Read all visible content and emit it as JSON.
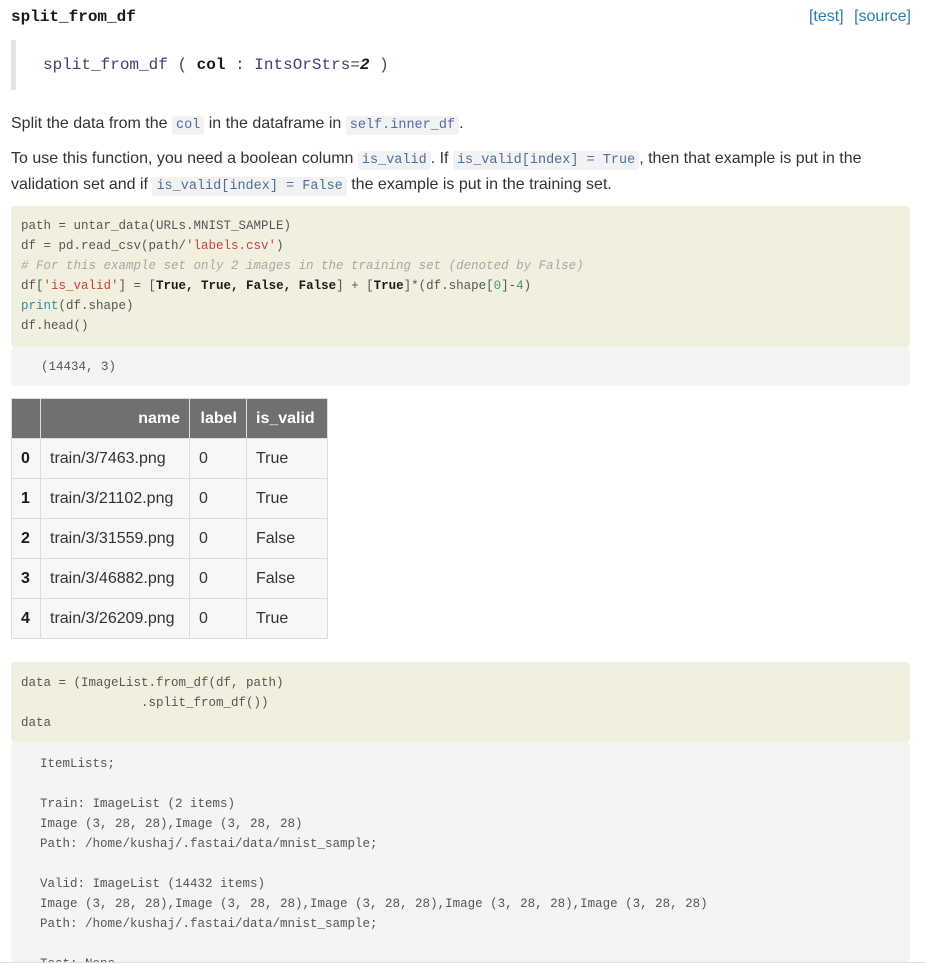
{
  "header": {
    "title": "split_from_df",
    "test_link": "[test]",
    "source_link": "[source]"
  },
  "signature": {
    "name": "split_from_df",
    "open": "(",
    "param": "col",
    "colon": ":",
    "type": "IntsOrStrs",
    "eq": "=",
    "default": "2",
    "close": ")"
  },
  "description": {
    "p1_a": "Split the data from the",
    "p1_code1": "col",
    "p1_b": "in the dataframe in",
    "p1_code2": "self.inner_df",
    "p1_c": ".",
    "p2_a": "To use this function, you need a boolean column",
    "p2_code1": "is_valid",
    "p2_b": ". If",
    "p2_code2": "is_valid[index] = True",
    "p2_c": ", then that example is put in the",
    "p2_d": "validation set and if",
    "p2_code3": "is_valid[index] = False",
    "p2_e": "the example is put in the training set."
  },
  "code1": {
    "l1_a": "path = untar_data(URLs.MNIST_SAMPLE)",
    "l2_a": "df = pd.read_csv(path/",
    "l2_str": "'labels.csv'",
    "l2_b": ")",
    "l3": "# For this example set only 2 images in the training set (denoted by False)",
    "l4_a": "df[",
    "l4_str": "'is_valid'",
    "l4_b": "] = [",
    "l4_kw": "True, True, False, False",
    "l4_c": "] + [",
    "l4_kw2": "True",
    "l4_d": "]*(df.shape[",
    "l4_n0": "0",
    "l4_e": "]-",
    "l4_n4": "4",
    "l4_f": ")",
    "l5_fn": "print",
    "l5_b": "(df.shape)",
    "l6": "df.head()"
  },
  "output1": "(14434, 3)",
  "table": {
    "headers": [
      "",
      "name",
      "label",
      "is_valid"
    ],
    "rows": [
      {
        "idx": "0",
        "name": "train/3/7463.png",
        "label": "0",
        "is_valid": "True"
      },
      {
        "idx": "1",
        "name": "train/3/21102.png",
        "label": "0",
        "is_valid": "True"
      },
      {
        "idx": "2",
        "name": "train/3/31559.png",
        "label": "0",
        "is_valid": "False"
      },
      {
        "idx": "3",
        "name": "train/3/46882.png",
        "label": "0",
        "is_valid": "False"
      },
      {
        "idx": "4",
        "name": "train/3/26209.png",
        "label": "0",
        "is_valid": "True"
      }
    ]
  },
  "code2": {
    "l1": "data = (ImageList.from_df(df, path)",
    "l2": "                .split_from_df())",
    "l3": "data"
  },
  "output2": {
    "l1": "ItemLists;",
    "l2": "Train: ImageList (2 items)",
    "l3": "Image (3, 28, 28),Image (3, 28, 28)",
    "l4": "Path: /home/kushaj/.fastai/data/mnist_sample;",
    "l5": "Valid: ImageList (14432 items)",
    "l6": "Image (3, 28, 28),Image (3, 28, 28),Image (3, 28, 28),Image (3, 28, 28),Image (3, 28, 28)",
    "l7": "Path: /home/kushaj/.fastai/data/mnist_sample;",
    "l8": "Test: None"
  }
}
